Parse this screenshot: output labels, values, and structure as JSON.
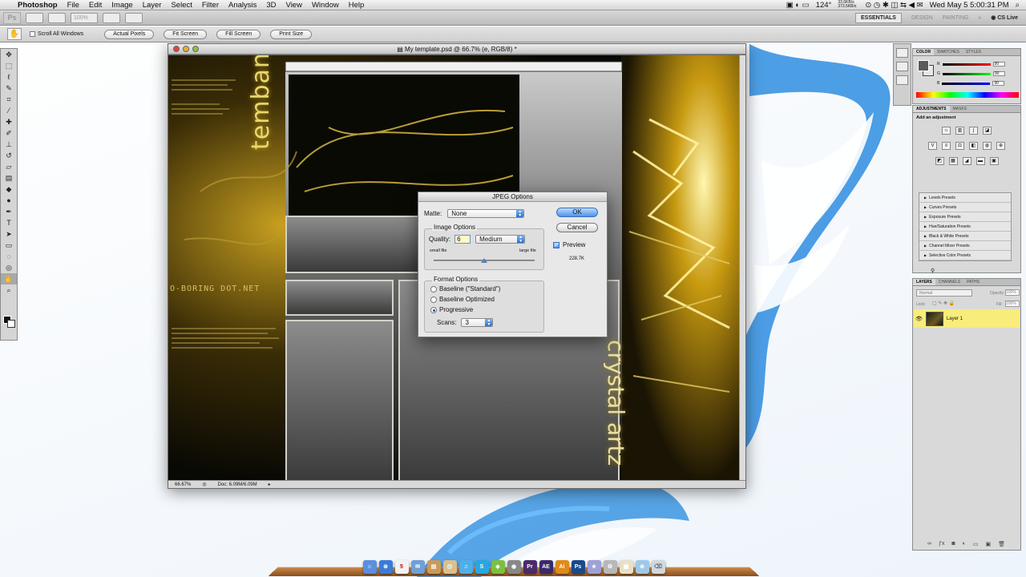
{
  "menubar": {
    "app_name": "Photoshop",
    "menus": [
      "File",
      "Edit",
      "Image",
      "Layer",
      "Select",
      "Filter",
      "Analysis",
      "3D",
      "View",
      "Window",
      "Help"
    ],
    "battery": "124°",
    "net_up": "33.6KB/s",
    "net_down": "373.5KB/s",
    "clock": "Wed May 5  5:00:31 PM"
  },
  "appbar": {
    "logo": "Ps",
    "zoom": "100%",
    "workspaces": [
      "ESSENTIALS",
      "DESIGN",
      "PAINTING"
    ],
    "cs_live": "CS Live"
  },
  "optionsbar": {
    "scroll_all_windows": "Scroll All Windows",
    "buttons": [
      "Actual Pixels",
      "Fit Screen",
      "Fill Screen",
      "Print Size"
    ]
  },
  "document": {
    "title": "My template.psd @ 66.7% (e, RGB/8) *",
    "zoom": "66.67%",
    "doc_size": "Doc: 6.09M/6.09M",
    "brand_left": "tembanics",
    "brand_right": "crystal artz",
    "brand_url": "O-BORING  DOT.NET"
  },
  "jpeg_dialog": {
    "title": "JPEG Options",
    "matte_label": "Matte:",
    "matte_value": "None",
    "image_options_label": "Image Options",
    "quality_label": "Quality:",
    "quality_value": "6",
    "quality_preset": "Medium",
    "small_file": "small file",
    "large_file": "large file",
    "quality_fraction": 0.5,
    "format_options_label": "Format Options",
    "formats": [
      "Baseline (\"Standard\")",
      "Baseline Optimized",
      "Progressive"
    ],
    "selected_format": "Progressive",
    "scans_label": "Scans:",
    "scans_value": "3",
    "ok_label": "OK",
    "cancel_label": "Cancel",
    "preview_label": "Preview",
    "preview_checked": true,
    "file_size": "228.7K"
  },
  "color_panel": {
    "tabs": [
      "COLOR",
      "SWATCHES",
      "STYLES"
    ],
    "channels": [
      {
        "label": "R",
        "value": "90"
      },
      {
        "label": "G",
        "value": "90"
      },
      {
        "label": "B",
        "value": "90"
      }
    ]
  },
  "adjustments_panel": {
    "tabs": [
      "ADJUSTMENTS",
      "MASKS"
    ],
    "heading": "Add an adjustment",
    "presets": [
      "Levels Presets",
      "Curves Presets",
      "Exposure Presets",
      "Hue/Saturation Presets",
      "Black & White Presets",
      "Channel Mixer Presets",
      "Selective Color Presets"
    ]
  },
  "layers_panel": {
    "tabs": [
      "LAYERS",
      "CHANNELS",
      "PATHS"
    ],
    "blend_mode": "Normal",
    "opacity_label": "Opacity:",
    "opacity_value": "100%",
    "lock_label": "Lock:",
    "fill_label": "Fill:",
    "fill_value": "100%",
    "layer_name": "Layer 1"
  },
  "dock": {
    "apps": [
      "Finder",
      "Safari",
      "iCal",
      "Mail",
      "Preview",
      "Address",
      "iTunes",
      "Skype",
      "Camino",
      "Pr",
      "AE",
      "Ai",
      "Ps",
      "iMovie",
      "Photos",
      "System",
      "Folder",
      "Trash"
    ]
  },
  "colors": {
    "accent": "#4f93e8",
    "layer_selected": "#f8ec7a"
  }
}
